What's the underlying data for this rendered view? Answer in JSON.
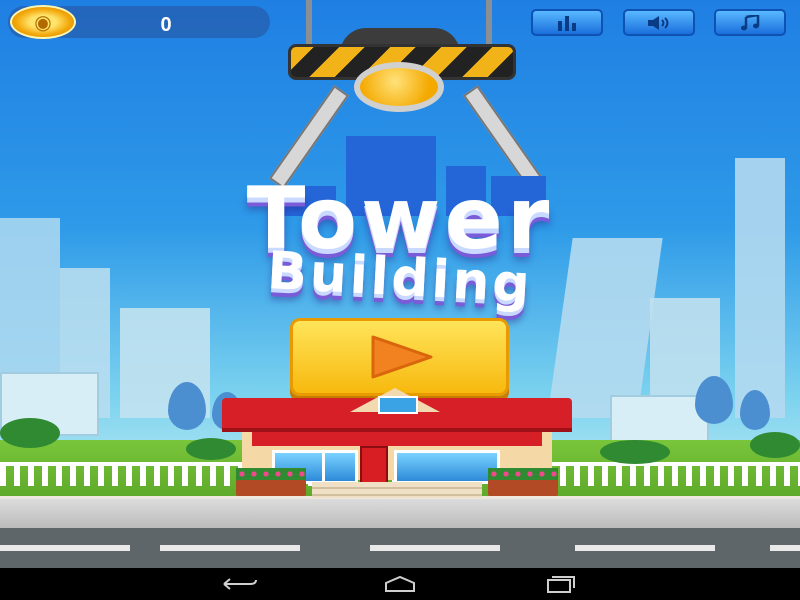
{
  "hud": {
    "coin_count": "0",
    "buttons": [
      {
        "name": "leaderboard-button",
        "icon": "bar-chart-icon"
      },
      {
        "name": "sound-button",
        "icon": "speaker-icon"
      },
      {
        "name": "music-button",
        "icon": "music-note-icon"
      }
    ]
  },
  "title": {
    "line1": "Tower",
    "line2": "Building"
  },
  "play_button": {
    "icon": "play-triangle-icon",
    "color": "#f7b90e",
    "arrow_color": "#f2821f"
  },
  "colors": {
    "sky_top": "#1f7fe3",
    "roof": "#d61f26",
    "grass": "#79c53a",
    "road": "#5f6669"
  },
  "navbar": {
    "items": [
      "back-icon",
      "home-icon",
      "recent-apps-icon"
    ]
  }
}
